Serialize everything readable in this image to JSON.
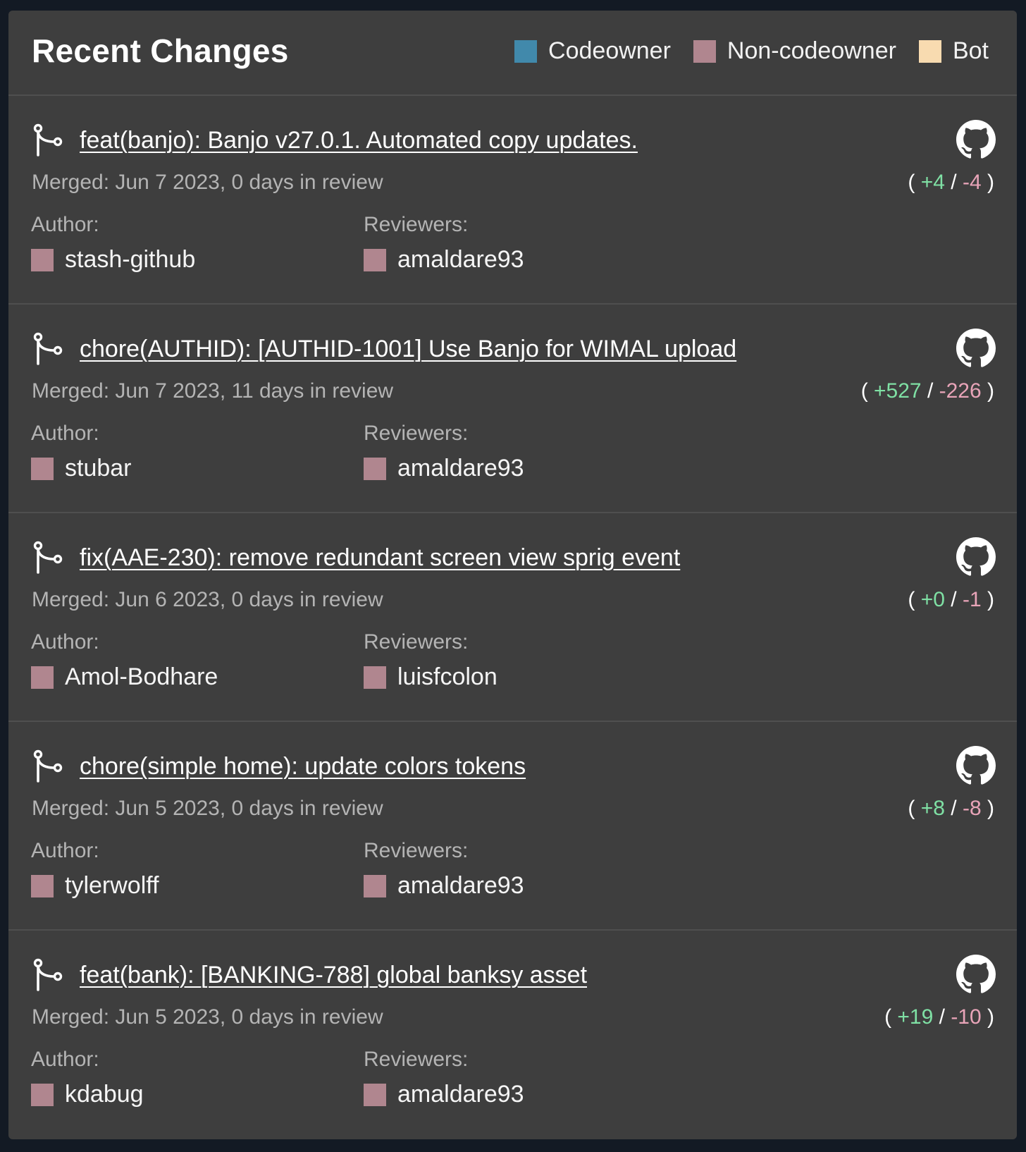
{
  "header": {
    "title": "Recent Changes",
    "legend": [
      {
        "label": "Codeowner",
        "color": "#4189ab"
      },
      {
        "label": "Non-codeowner",
        "color": "#b0868f"
      },
      {
        "label": "Bot",
        "color": "#f8dbb0"
      }
    ]
  },
  "labels": {
    "author": "Author:",
    "reviewers": "Reviewers:",
    "open_paren": "( ",
    "slash": " / ",
    "close_paren": " )"
  },
  "icons": {
    "merge": "git-merge-icon",
    "github": "github-icon"
  },
  "prs": [
    {
      "title": "feat(banjo): Banjo v27.0.1. Automated copy updates.",
      "merged": "Merged: Jun 7 2023, 0 days in review",
      "additions": "+4",
      "deletions": "-4",
      "author": "stash-github",
      "reviewer": "amaldare93"
    },
    {
      "title": "chore(AUTHID): [AUTHID-1001] Use Banjo for WIMAL upload",
      "merged": "Merged: Jun 7 2023, 11 days in review",
      "additions": "+527",
      "deletions": "-226",
      "author": "stubar",
      "reviewer": "amaldare93"
    },
    {
      "title": "fix(AAE-230): remove redundant screen view sprig event",
      "merged": "Merged: Jun 6 2023, 0 days in review",
      "additions": "+0",
      "deletions": "-1",
      "author": "Amol-Bodhare",
      "reviewer": "luisfcolon"
    },
    {
      "title": "chore(simple home): update colors tokens",
      "merged": "Merged: Jun 5 2023, 0 days in review",
      "additions": "+8",
      "deletions": "-8",
      "author": "tylerwolff",
      "reviewer": "amaldare93"
    },
    {
      "title": "feat(bank): [BANKING-788] global banksy asset",
      "merged": "Merged: Jun 5 2023, 0 days in review",
      "additions": "+19",
      "deletions": "-10",
      "author": "kdabug",
      "reviewer": "amaldare93"
    }
  ]
}
